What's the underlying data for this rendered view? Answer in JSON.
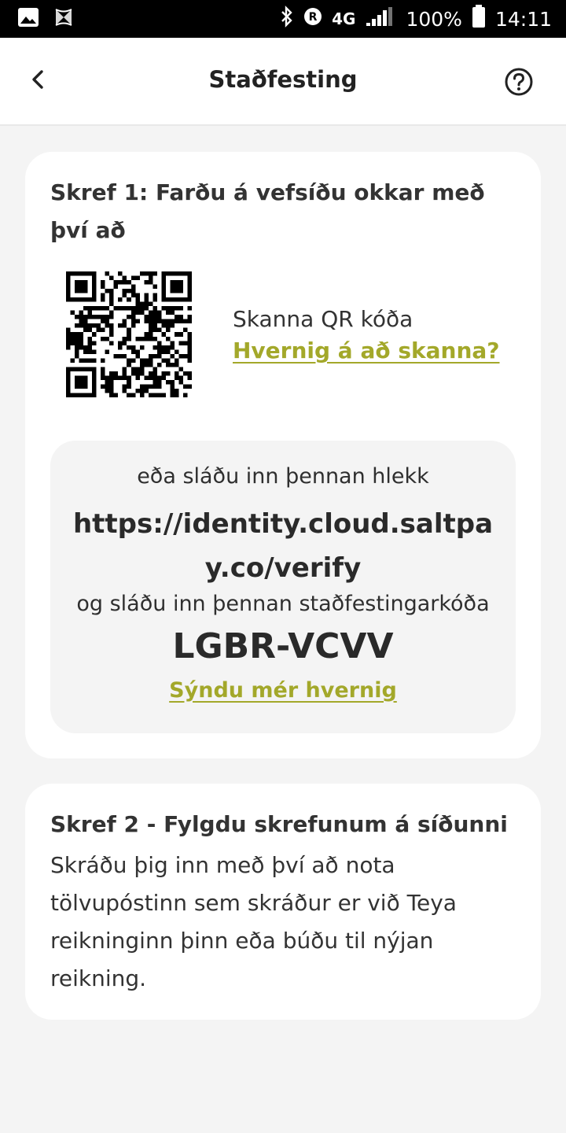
{
  "status_bar": {
    "network": "4G",
    "battery": "100%",
    "time": "14:11",
    "icons": [
      "image-icon",
      "fan-icon",
      "bluetooth-icon",
      "registered-icon",
      "signal-icon",
      "battery-icon"
    ]
  },
  "header": {
    "title": "Staðfesting",
    "back_icon": "chevron-left-icon",
    "help_icon": "help-circle-icon"
  },
  "step1": {
    "title": "Skref 1: Farðu á vefsíðu okkar með því að",
    "scan_text": "Skanna QR kóða",
    "scan_link": "Hvernig á að skanna?",
    "or_text": "eða sláðu inn þennan hlekk",
    "url": "https://identity.cloud.saltpay.co/verify",
    "code_text": "og sláðu inn þennan staðfestingarkóða",
    "code": "LGBR-VCVV",
    "show_link": "Sýndu mér hvernig"
  },
  "step2": {
    "title": "Skref 2 - Fylgdu skrefunum á síðunni",
    "description": "Skráðu þig inn með því að nota tölvupóstinn sem skráður er við Teya reikninginn þinn eða búðu til nýjan reikning."
  },
  "colors": {
    "accent": "#a3a82a",
    "background": "#f4f4f4",
    "card": "#ffffff",
    "text": "#2f2f2f"
  }
}
